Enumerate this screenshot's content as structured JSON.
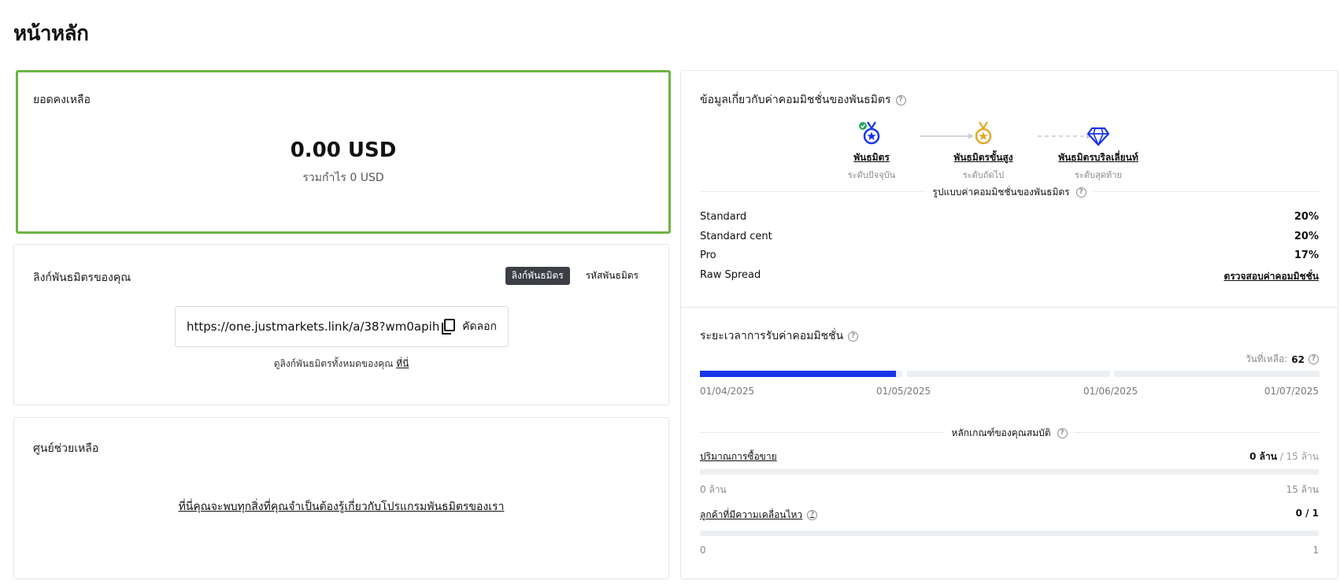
{
  "page": {
    "title": "หน้าหลัก"
  },
  "balance": {
    "title": "ยอดคงเหลือ",
    "amount": "0.00 USD",
    "subtitle": "รวมกำไร 0 USD"
  },
  "partner_link": {
    "title": "ลิงก์พันธมิตรของคุณ",
    "tabs": [
      {
        "label": "ลิงก์พันธมิตร",
        "active": true
      },
      {
        "label": "รหัสพันธมิตร",
        "active": false
      }
    ],
    "url": "https://one.justmarkets.link/a/38?wm0apih",
    "copy_label": "คัดลอก",
    "note_prefix": "ดูลิงก์พันธมิตรทั้งหมดของคุณ",
    "note_link": "ที่นี่"
  },
  "help": {
    "title": "ศูนย์ช่วยเหลือ",
    "link": "ที่นี่คุณจะพบทุกสิ่งที่คุณจำเป็นต้องรู้เกี่ยวกับโปรแกรมพันธมิตรของเรา"
  },
  "commission": {
    "title": "ข้อมูลเกี่ยวกับค่าคอมมิชชั่นของพันธมิตร",
    "tiers": [
      {
        "name": "พันธมิตร",
        "status": "ระดับปัจจุบัน",
        "icon": "blue-medal-icon",
        "current": true
      },
      {
        "name": "พันธมิตรขั้นสูง",
        "status": "ระดับถัดไป",
        "icon": "gold-medal-icon",
        "current": false
      },
      {
        "name": "พันธมิตรบริลเลี่ยนท์",
        "status": "ระดับสุดท้าย",
        "icon": "diamond-icon",
        "current": false
      }
    ],
    "rates_title": "รูปแบบค่าคอมมิชชั่นของพันธมิตร",
    "rates": [
      {
        "label": "Standard",
        "value": "20%"
      },
      {
        "label": "Standard cent",
        "value": "20%"
      },
      {
        "label": "Pro",
        "value": "17%"
      }
    ],
    "raw_spread": {
      "label": "Raw Spread",
      "link": "ตรวจสอบค่าคอมมิชชั่น"
    }
  },
  "period": {
    "title": "ระยะเวลาการรับค่าคอมมิชชั่น",
    "days_left_label": "วันที่เหลือ:",
    "days_left_value": "62",
    "dates": [
      "01/04/2025",
      "01/05/2025",
      "01/06/2025",
      "01/07/2025"
    ],
    "segment_progress": [
      0.97,
      0,
      0
    ],
    "criteria_title": "หลักเกณฑ์ของคุณสมบัติ",
    "criteria": [
      {
        "label": "ปริมาณการซื้อขาย",
        "current": "0 ล้าน",
        "target": "/ 15 ล้าน",
        "min": "0 ล้าน",
        "max": "15 ล้าน",
        "progress": 0
      },
      {
        "label": "ลูกค้าที่มีความเคลื่อนไหว",
        "current": "0 / 1",
        "target": "",
        "min": "0",
        "max": "1",
        "progress": 0
      }
    ],
    "colors": {
      "progress": "#1a34e8",
      "track": "#eceff2"
    }
  }
}
